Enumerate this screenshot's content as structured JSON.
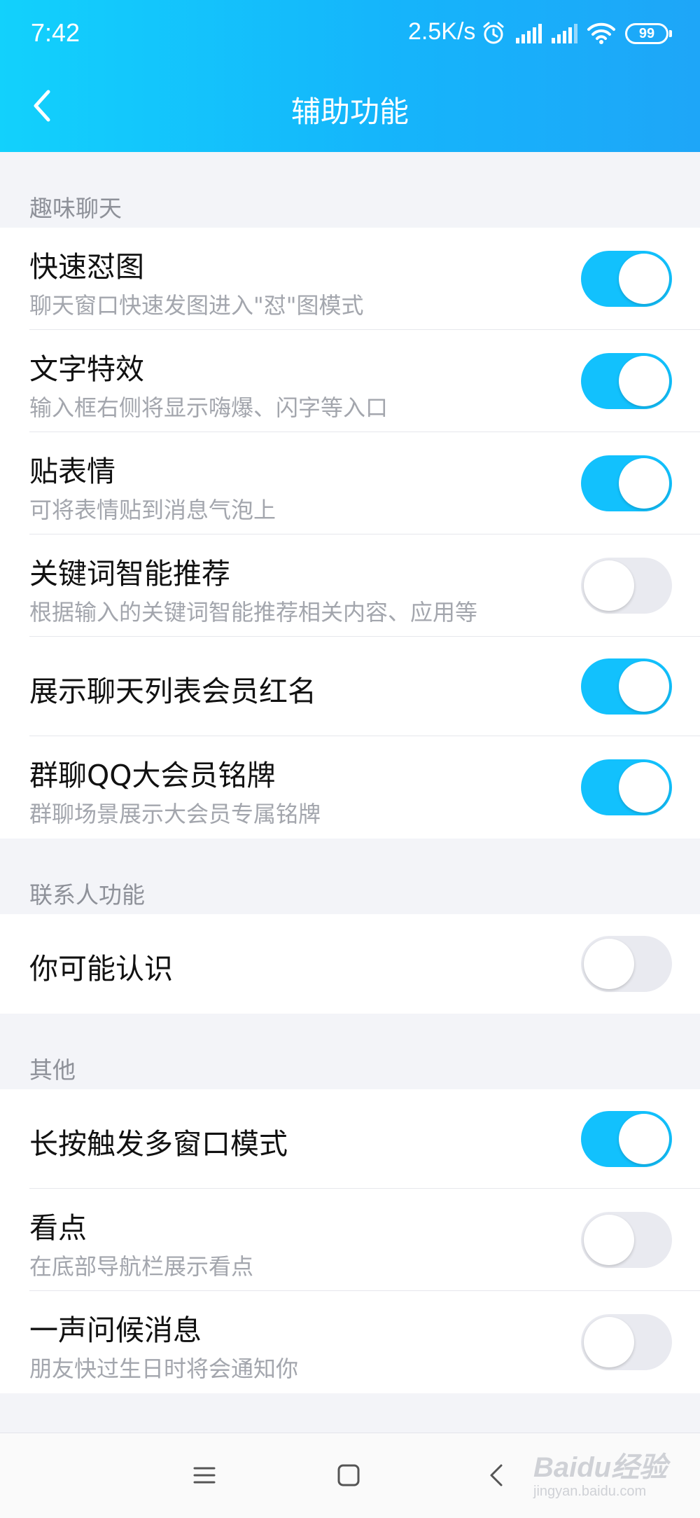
{
  "status_bar": {
    "time": "7:42",
    "network_speed": "2.5K/s",
    "battery": "99",
    "icons": [
      "alarm-icon",
      "signal-icon",
      "signal-icon",
      "wifi-icon",
      "battery-icon"
    ]
  },
  "nav": {
    "title": "辅助功能",
    "back_icon": "chevron-left-icon"
  },
  "sections": {
    "fun_chat": {
      "header": "趣味聊天",
      "items": [
        {
          "title": "快速怼图",
          "desc": "聊天窗口快速发图进入\"怼\"图模式",
          "on": true
        },
        {
          "title": "文字特效",
          "desc": "输入框右侧将显示嗨爆、闪字等入口",
          "on": true
        },
        {
          "title": "贴表情",
          "desc": "可将表情贴到消息气泡上",
          "on": true
        },
        {
          "title": "关键词智能推荐",
          "desc": "根据输入的关键词智能推荐相关内容、应用等",
          "on": false
        },
        {
          "title": "展示聊天列表会员红名",
          "desc": "",
          "on": true
        },
        {
          "title": "群聊QQ大会员铭牌",
          "desc": "群聊场景展示大会员专属铭牌",
          "on": true
        }
      ]
    },
    "contacts": {
      "header": "联系人功能",
      "items": [
        {
          "title": "你可能认识",
          "desc": "",
          "on": false
        }
      ]
    },
    "other": {
      "header": "其他",
      "items": [
        {
          "title": "长按触发多窗口模式",
          "desc": "",
          "on": true
        },
        {
          "title": "看点",
          "desc": "在底部导航栏展示看点",
          "on": false
        },
        {
          "title": "一声问候消息",
          "desc": "朋友快过生日时将会通知你",
          "on": false
        }
      ]
    }
  },
  "system_nav": {
    "icons": [
      "menu-icon",
      "home-icon",
      "back-icon"
    ]
  },
  "watermark": {
    "main": "Baidu经验",
    "sub": "jingyan.baidu.com"
  },
  "colors": {
    "header_start": "#12d1fc",
    "header_end": "#1ea6f8",
    "toggle_on": "#12c1fd",
    "toggle_off": "#e9eaf0",
    "background": "#f3f4f8"
  }
}
